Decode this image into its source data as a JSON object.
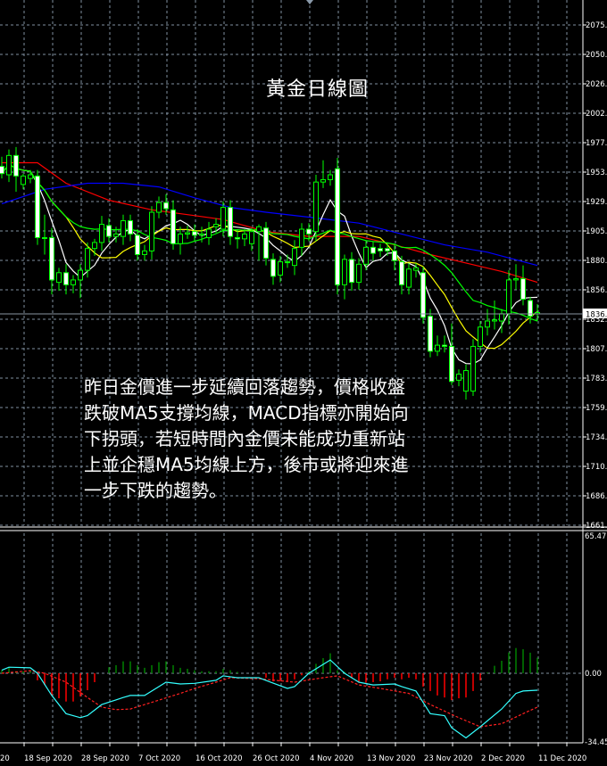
{
  "title": "黃金日線圖",
  "commentary": [
    "昨日金價進一步延續回落趨勢，價格收盤",
    "跌破MA5支撐均線，MACD指標亦開始向",
    "下拐頭，若短時間內金價未能成功重新站",
    "上並企穩MA5均線上方，後市或將迎來進",
    "一步下跌的趨勢。"
  ],
  "colors": {
    "background": "#000000",
    "grid": "#8090a0",
    "bull": "#00ff00",
    "bear_body": "#ffffff",
    "ma_fast": "#ffffff",
    "ma_mid": "#ffff00",
    "ma_slow": "#00ff00",
    "ma_red": "#ff0000",
    "ma_blue": "#0000ff",
    "macd_line": "#33ffff",
    "signal_line": "#ff2020",
    "hist_up": "#008000",
    "hist_down": "#ff0000"
  },
  "chart_data": [
    {
      "type": "candlestick",
      "name": "price",
      "current_price_label": "1836.",
      "ylim": [
        1661,
        2075
      ],
      "y_tick_labels": [
        "2075.",
        "2050.",
        "2026.",
        "2002.",
        "1977.",
        "1953.",
        "1929.",
        "1905.",
        "1880.",
        "1856.",
        "1832.",
        "1807.",
        "1783.",
        "1759.",
        "1734.",
        "1710.",
        "1686.",
        "1661."
      ],
      "x_tick_labels": [
        {
          "bar": -5,
          "label": "20"
        },
        {
          "bar": 3,
          "label": "18 Sep 2020"
        },
        {
          "bar": 11,
          "label": "28 Sep 2020"
        },
        {
          "bar": 19,
          "label": "7 Oct 2020"
        },
        {
          "bar": 27,
          "label": "16 Oct 2020"
        },
        {
          "bar": 35,
          "label": "26 Oct 2020"
        },
        {
          "bar": 43,
          "label": "4 Nov 2020"
        },
        {
          "bar": 51,
          "label": "13 Nov 2020"
        },
        {
          "bar": 59,
          "label": "23 Nov 2020"
        },
        {
          "bar": 67,
          "label": "2 Dec 2020"
        },
        {
          "bar": 75,
          "label": "11 Dec 2020"
        }
      ],
      "ohlc": [
        [
          1958,
          1966,
          1948,
          1952
        ],
        [
          1951,
          1972,
          1945,
          1967
        ],
        [
          1967,
          1974,
          1937,
          1950
        ],
        [
          1943,
          1952,
          1939,
          1950
        ],
        [
          1948,
          1955,
          1944,
          1951
        ],
        [
          1950,
          1955,
          1893,
          1899
        ],
        [
          1899,
          1918,
          1885,
          1899
        ],
        [
          1899,
          1907,
          1852,
          1864
        ],
        [
          1862,
          1874,
          1855,
          1870
        ],
        [
          1870,
          1877,
          1852,
          1860
        ],
        [
          1860,
          1868,
          1853,
          1864
        ],
        [
          1864,
          1877,
          1849,
          1872
        ],
        [
          1872,
          1895,
          1866,
          1890
        ],
        [
          1890,
          1898,
          1884,
          1895
        ],
        [
          1895,
          1917,
          1888,
          1910
        ],
        [
          1909,
          1915,
          1895,
          1900
        ],
        [
          1900,
          1908,
          1895,
          1902
        ],
        [
          1900,
          1918,
          1893,
          1913
        ],
        [
          1913,
          1918,
          1896,
          1902
        ],
        [
          1901,
          1906,
          1880,
          1885
        ],
        [
          1885,
          1893,
          1880,
          1888
        ],
        [
          1888,
          1925,
          1881,
          1920
        ],
        [
          1920,
          1933,
          1915,
          1928
        ],
        [
          1928,
          1935,
          1918,
          1923
        ],
        [
          1922,
          1930,
          1889,
          1894
        ],
        [
          1894,
          1908,
          1885,
          1902
        ],
        [
          1902,
          1909,
          1898,
          1903
        ],
        [
          1904,
          1910,
          1896,
          1901
        ],
        [
          1901,
          1908,
          1895,
          1902
        ],
        [
          1899,
          1912,
          1893,
          1906
        ],
        [
          1908,
          1915,
          1903,
          1910
        ],
        [
          1906,
          1929,
          1900,
          1924
        ],
        [
          1924,
          1930,
          1893,
          1900
        ],
        [
          1899,
          1905,
          1890,
          1898
        ],
        [
          1898,
          1906,
          1892,
          1902
        ],
        [
          1894,
          1907,
          1888,
          1904
        ],
        [
          1904,
          1910,
          1880,
          1908
        ],
        [
          1907,
          1912,
          1876,
          1882
        ],
        [
          1881,
          1886,
          1860,
          1867
        ],
        [
          1868,
          1884,
          1862,
          1879
        ],
        [
          1879,
          1885,
          1874,
          1879
        ],
        [
          1876,
          1897,
          1868,
          1890
        ],
        [
          1891,
          1911,
          1884,
          1906
        ],
        [
          1906,
          1911,
          1896,
          1902
        ],
        [
          1904,
          1951,
          1896,
          1945
        ],
        [
          1945,
          1963,
          1940,
          1947
        ],
        [
          1947,
          1955,
          1942,
          1951
        ],
        [
          1956,
          1965,
          1852,
          1860
        ],
        [
          1860,
          1885,
          1848,
          1881
        ],
        [
          1881,
          1887,
          1855,
          1862
        ],
        [
          1862,
          1882,
          1856,
          1877
        ],
        [
          1877,
          1897,
          1872,
          1891
        ],
        [
          1891,
          1896,
          1880,
          1886
        ],
        [
          1890,
          1894,
          1883,
          1888
        ],
        [
          1890,
          1895,
          1884,
          1888
        ],
        [
          1888,
          1894,
          1872,
          1880
        ],
        [
          1879,
          1884,
          1852,
          1860
        ],
        [
          1858,
          1878,
          1852,
          1873
        ],
        [
          1872,
          1878,
          1866,
          1874
        ],
        [
          1870,
          1875,
          1828,
          1833
        ],
        [
          1834,
          1840,
          1800,
          1805
        ],
        [
          1805,
          1818,
          1801,
          1810
        ],
        [
          1810,
          1818,
          1804,
          1809
        ],
        [
          1809,
          1828,
          1777,
          1780
        ],
        [
          1781,
          1790,
          1776,
          1786
        ],
        [
          1772,
          1794,
          1765,
          1789
        ],
        [
          1772,
          1815,
          1768,
          1809
        ],
        [
          1809,
          1830,
          1804,
          1825
        ],
        [
          1825,
          1840,
          1818,
          1830
        ],
        [
          1830,
          1847,
          1823,
          1831
        ],
        [
          1830,
          1840,
          1820,
          1836
        ],
        [
          1836,
          1872,
          1827,
          1864
        ],
        [
          1864,
          1877,
          1856,
          1865
        ],
        [
          1865,
          1876,
          1843,
          1848
        ],
        [
          1847,
          1850,
          1828,
          1834
        ],
        [
          1836,
          1844,
          1830,
          1837
        ]
      ],
      "moving_averages_computed": [
        {
          "period": 5,
          "color_key": "ma_fast"
        },
        {
          "period": 10,
          "color_key": "ma_mid"
        },
        {
          "period": 20,
          "color_key": "ma_slow"
        }
      ],
      "moving_averages_sampled": [
        {
          "name": "ma-red",
          "color_key": "ma_red",
          "points": [
            [
              0,
              1961
            ],
            [
              5,
              1961
            ],
            [
              9,
              1944
            ],
            [
              15,
              1930
            ],
            [
              21,
              1922
            ],
            [
              26,
              1918
            ],
            [
              31,
              1914
            ],
            [
              37,
              1904
            ],
            [
              43,
              1900
            ],
            [
              50,
              1900
            ],
            [
              55,
              1893
            ],
            [
              60,
              1885
            ],
            [
              65,
              1878
            ],
            [
              70,
              1871
            ],
            [
              75,
              1862
            ]
          ]
        },
        {
          "name": "ma-blue",
          "color_key": "ma_blue",
          "points": [
            [
              0,
              1927
            ],
            [
              6,
              1939
            ],
            [
              12,
              1944
            ],
            [
              17,
              1944
            ],
            [
              22,
              1941
            ],
            [
              27,
              1932
            ],
            [
              32,
              1924
            ],
            [
              37,
              1920
            ],
            [
              43,
              1916
            ],
            [
              50,
              1911
            ],
            [
              56,
              1902
            ],
            [
              62,
              1893
            ],
            [
              68,
              1887
            ],
            [
              75,
              1876
            ]
          ]
        }
      ]
    },
    {
      "type": "macd",
      "name": "macd",
      "ylim": [
        -34.45,
        65.47
      ],
      "y_tick_labels": [
        {
          "value": 65.47,
          "label": "65.47"
        },
        {
          "value": 0,
          "label": "0.00"
        },
        {
          "value": -34.45,
          "label": "-34.45"
        }
      ],
      "histogram": [
        1.5,
        2.7,
        1,
        1,
        1,
        -3.5,
        -5.8,
        -11,
        -12.4,
        -14,
        -14,
        -11.5,
        -8.4,
        -4.4,
        0,
        3,
        4,
        5.9,
        5.9,
        4,
        2.7,
        4,
        5.5,
        5.9,
        4,
        2.7,
        2.2,
        1.5,
        1,
        1,
        1,
        2.2,
        1.5,
        0.7,
        0,
        0,
        0,
        -2.2,
        -4,
        -4,
        -4,
        -3,
        -1,
        1,
        4.7,
        7.5,
        9.9,
        1.5,
        0.7,
        -2.2,
        -4.7,
        -4.7,
        -4.4,
        -4,
        -3,
        -2.2,
        -3,
        -2.2,
        -3,
        -6.6,
        -8.8,
        -11,
        -12,
        -13.3,
        -12.4,
        -12,
        -8.8,
        -3.5,
        0.4,
        3.7,
        6.2,
        10.3,
        12.5,
        11.9,
        10.2,
        7.7
      ],
      "main_line": [
        [
          0,
          1.5
        ],
        [
          1,
          3
        ],
        [
          4,
          2.7
        ],
        [
          5,
          0
        ],
        [
          7,
          -11
        ],
        [
          9,
          -20
        ],
        [
          11,
          -22
        ],
        [
          12,
          -21
        ],
        [
          14,
          -15.5
        ],
        [
          17,
          -12
        ],
        [
          18,
          -11
        ],
        [
          20,
          -11
        ],
        [
          23,
          -4.4
        ],
        [
          25,
          -5.3
        ],
        [
          27,
          -5
        ],
        [
          30,
          -3.5
        ],
        [
          31,
          -1.3
        ],
        [
          33,
          -2.2
        ],
        [
          36,
          -2.2
        ],
        [
          38,
          -4.9
        ],
        [
          40,
          -7.5
        ],
        [
          41,
          -6.6
        ],
        [
          43,
          0
        ],
        [
          46,
          6.6
        ],
        [
          48,
          0
        ],
        [
          50,
          -4.4
        ],
        [
          52,
          -5.8
        ],
        [
          55,
          -5.3
        ],
        [
          56,
          -6.6
        ],
        [
          58,
          -8.8
        ],
        [
          60,
          -20
        ],
        [
          62,
          -21
        ],
        [
          63,
          -27
        ],
        [
          65,
          -32
        ],
        [
          67,
          -26.5
        ],
        [
          70,
          -17.7
        ],
        [
          72,
          -10
        ],
        [
          73,
          -8.8
        ],
        [
          75,
          -8.4
        ]
      ],
      "signal_line": [
        [
          0,
          0
        ],
        [
          4,
          1.3
        ],
        [
          6,
          0
        ],
        [
          9,
          -4.4
        ],
        [
          12,
          -12
        ],
        [
          14,
          -16.8
        ],
        [
          16,
          -18
        ],
        [
          18,
          -17.7
        ],
        [
          20,
          -15.5
        ],
        [
          22,
          -13.3
        ],
        [
          25,
          -10
        ],
        [
          27,
          -7.5
        ],
        [
          30,
          -4.4
        ],
        [
          32,
          -2.2
        ],
        [
          36,
          -2.7
        ],
        [
          41,
          -4.4
        ],
        [
          45,
          -2.2
        ],
        [
          47,
          -1.3
        ],
        [
          50,
          -5.8
        ],
        [
          53,
          -7.5
        ],
        [
          57,
          -10
        ],
        [
          60,
          -15.5
        ],
        [
          64,
          -22
        ],
        [
          67,
          -26.5
        ],
        [
          70,
          -25
        ],
        [
          73,
          -20
        ],
        [
          75,
          -16.8
        ]
      ]
    }
  ]
}
